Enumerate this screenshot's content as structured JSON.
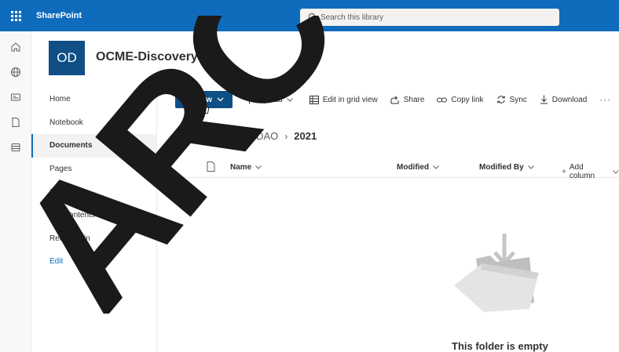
{
  "suitebar": {
    "brand": "SharePoint",
    "search_placeholder": "Search this library"
  },
  "site": {
    "logo_initials": "OD",
    "title": "OCME-DiscoveryLaw"
  },
  "leftnav": {
    "items": [
      {
        "label": "Home"
      },
      {
        "label": "Notebook"
      },
      {
        "label": "Documents"
      },
      {
        "label": "Pages"
      },
      {
        "label": "2021"
      },
      {
        "label": "Site contents"
      },
      {
        "label": "Recycle bin"
      },
      {
        "label": "Edit"
      }
    ],
    "active": "Documents"
  },
  "command_bar": {
    "new_label": "New",
    "upload_label": "Upload",
    "grid_label": "Edit in grid view",
    "share_label": "Share",
    "copylink_label": "Copy link",
    "sync_label": "Sync",
    "download_label": "Download",
    "more_label": "···"
  },
  "breadcrumb": {
    "items": [
      "Documents",
      "BXDAO",
      "2021"
    ]
  },
  "columns": {
    "name": "Name",
    "modified": "Modified",
    "modified_by": "Modified By",
    "add_column": "Add column"
  },
  "empty_state": {
    "message": "This folder is empty"
  },
  "colors": {
    "suitebar": "#0f6cbd",
    "primary_button": "#0f4f86",
    "site_logo": "#0f4f86"
  },
  "icons": {
    "app_launcher": "waffle-icon",
    "search": "search-icon",
    "rail": [
      "home-icon",
      "globe-icon",
      "news-icon",
      "file-icon",
      "list-icon"
    ]
  }
}
